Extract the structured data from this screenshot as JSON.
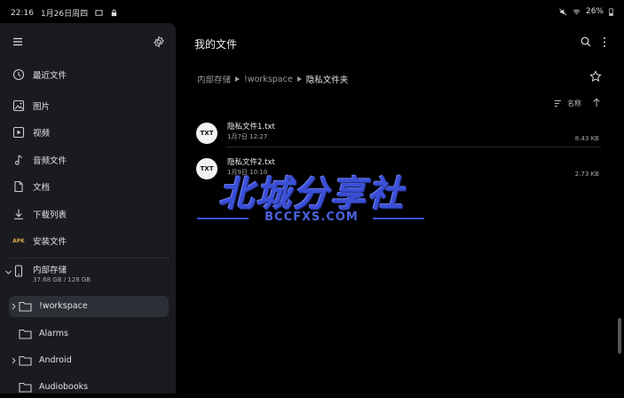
{
  "status": {
    "time": "22:16",
    "date": "1月26日周四",
    "battery": "26%"
  },
  "sidebar": {
    "nav": [
      {
        "label": "最近文件",
        "icon": "clock-icon"
      },
      {
        "label": "图片",
        "icon": "image-icon"
      },
      {
        "label": "视频",
        "icon": "video-icon"
      },
      {
        "label": "音频文件",
        "icon": "music-icon"
      },
      {
        "label": "文档",
        "icon": "document-icon"
      },
      {
        "label": "下载列表",
        "icon": "download-icon"
      },
      {
        "label": "安装文件",
        "icon": "apk-icon",
        "badge": "APK"
      }
    ],
    "storage": {
      "name": "内部存储",
      "capacity": "37.68 GB / 128 GB"
    },
    "folders": [
      {
        "label": "!workspace",
        "selected": true
      },
      {
        "label": "Alarms",
        "selected": false
      },
      {
        "label": "Android",
        "selected": false
      },
      {
        "label": "Audiobooks",
        "selected": false
      }
    ]
  },
  "main": {
    "title": "我的文件",
    "breadcrumb": [
      "内部存储",
      "!workspace",
      "隐私文件夹"
    ],
    "sort_label": "名称",
    "files": [
      {
        "name": "隐私文件1.txt",
        "date": "1月7日 12:27",
        "size": "8.43 KB",
        "type": "TXT"
      },
      {
        "name": "隐私文件2.txt",
        "date": "1月9日 10:10",
        "size": "2.73 KB",
        "type": "TXT"
      }
    ]
  },
  "watermark": {
    "main": "北城分享社",
    "sub": "BCCFXS.COM"
  },
  "colors": {
    "sidebar_bg": "#191b1f",
    "accent_watermark": "#3a4fd6",
    "apk_badge": "#d8a64a"
  }
}
